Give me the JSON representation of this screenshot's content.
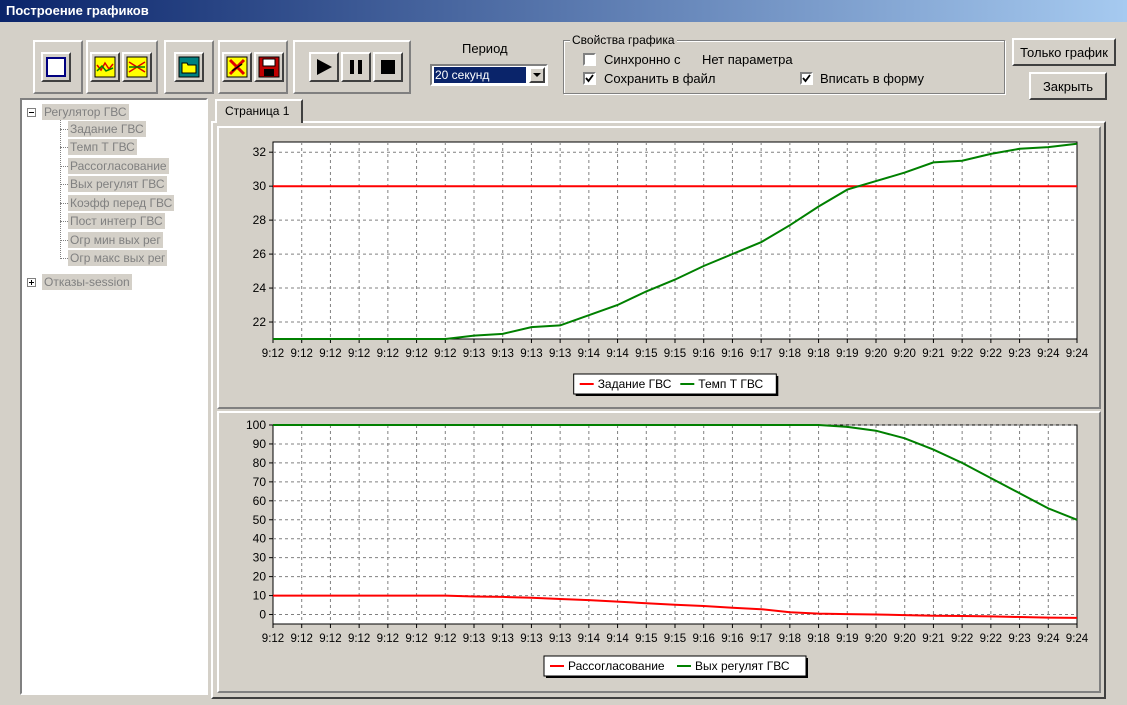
{
  "window": {
    "title": "Построение графиков"
  },
  "toolbar": {
    "groups": [
      {
        "buttons": [
          "new-chart-icon"
        ]
      },
      {
        "buttons": [
          "chart-wave-icon",
          "chart-cross-icon"
        ]
      },
      {
        "buttons": [
          "open-folder-icon"
        ]
      },
      {
        "buttons": [
          "delete-chart-icon",
          "save-disk-icon"
        ]
      },
      {
        "buttons": [
          "play-icon",
          "pause-icon",
          "stop-icon"
        ]
      }
    ]
  },
  "period": {
    "label": "Период",
    "value": "20 секунд"
  },
  "properties": {
    "legend": "Свойства графика",
    "sync_label": "Синхронно с",
    "sync_checked": false,
    "sync_param": "Нет параметра",
    "save_label": "Сохранить в файл",
    "save_checked": true,
    "fit_label": "Вписать в форму",
    "fit_checked": true
  },
  "buttons": {
    "only_chart": "Только график",
    "close": "Закрыть"
  },
  "tree": {
    "root": "Регулятор ГВС",
    "children": [
      "Задание ГВС",
      "Темп Т ГВС",
      "Рассогласование",
      "Вых регулят ГВС",
      "Коэфф перед ГВС",
      "Пост интегр ГВС",
      "Огр мин вых рег",
      "Огр макс вых рег"
    ],
    "second_root": "Отказы-session"
  },
  "tabs": [
    {
      "label": "Страница 1",
      "active": true
    }
  ],
  "colors": {
    "red": "#ff0000",
    "green": "#008000",
    "selection": "#0a246a",
    "face": "#d4d0c8"
  },
  "chart_data": [
    {
      "type": "line",
      "x": [
        "9:12",
        "9:12",
        "9:12",
        "9:12",
        "9:12",
        "9:12",
        "9:12",
        "9:13",
        "9:13",
        "9:13",
        "9:13",
        "9:14",
        "9:14",
        "9:15",
        "9:15",
        "9:16",
        "9:16",
        "9:17",
        "9:18",
        "9:18",
        "9:19",
        "9:20",
        "9:20",
        "9:21",
        "9:22",
        "9:22",
        "9:23",
        "9:24",
        "9:24"
      ],
      "ylim": [
        21,
        32.6
      ],
      "yticks": [
        22,
        24,
        26,
        28,
        30,
        32
      ],
      "grid": true,
      "legend": "bottom-center",
      "series": [
        {
          "name": "Задание ГВС",
          "color": "#ff0000",
          "values": [
            30,
            30,
            30,
            30,
            30,
            30,
            30,
            30,
            30,
            30,
            30,
            30,
            30,
            30,
            30,
            30,
            30,
            30,
            30,
            30,
            30,
            30,
            30,
            30,
            30,
            30,
            30,
            30,
            30
          ]
        },
        {
          "name": "Темп Т ГВС",
          "color": "#008000",
          "values": [
            21,
            21,
            21,
            21,
            21,
            21,
            21,
            21.2,
            21.3,
            21.7,
            21.8,
            22.4,
            23,
            23.8,
            24.5,
            25.3,
            26,
            26.7,
            27.7,
            28.8,
            29.8,
            30.3,
            30.8,
            31.4,
            31.5,
            31.9,
            32.2,
            32.3,
            32.5
          ]
        }
      ]
    },
    {
      "type": "line",
      "x": [
        "9:12",
        "9:12",
        "9:12",
        "9:12",
        "9:12",
        "9:12",
        "9:12",
        "9:13",
        "9:13",
        "9:13",
        "9:13",
        "9:14",
        "9:14",
        "9:15",
        "9:15",
        "9:16",
        "9:16",
        "9:17",
        "9:18",
        "9:18",
        "9:19",
        "9:20",
        "9:20",
        "9:21",
        "9:22",
        "9:22",
        "9:23",
        "9:24",
        "9:24"
      ],
      "ylim": [
        -5,
        100
      ],
      "yticks": [
        0,
        10,
        20,
        30,
        40,
        50,
        60,
        70,
        80,
        90,
        100
      ],
      "grid": true,
      "legend": "bottom-center",
      "series": [
        {
          "name": "Рассогласование",
          "color": "#ff0000",
          "values": [
            10,
            10,
            10,
            10,
            10,
            10,
            10,
            9.5,
            9.3,
            8.8,
            8.2,
            7.6,
            6.8,
            6,
            5.2,
            4.5,
            3.6,
            2.8,
            1.2,
            0.5,
            0.2,
            0,
            -0.3,
            -0.6,
            -0.8,
            -1,
            -1.3,
            -1.6,
            -1.8
          ]
        },
        {
          "name": "Вых регулят ГВС",
          "color": "#008000",
          "values": [
            100,
            100,
            100,
            100,
            100,
            100,
            100,
            100,
            100,
            100,
            100,
            100,
            100,
            100,
            100,
            100,
            100,
            100,
            100,
            100,
            99,
            97,
            93,
            87,
            80,
            72,
            64,
            56,
            50
          ]
        }
      ]
    }
  ]
}
